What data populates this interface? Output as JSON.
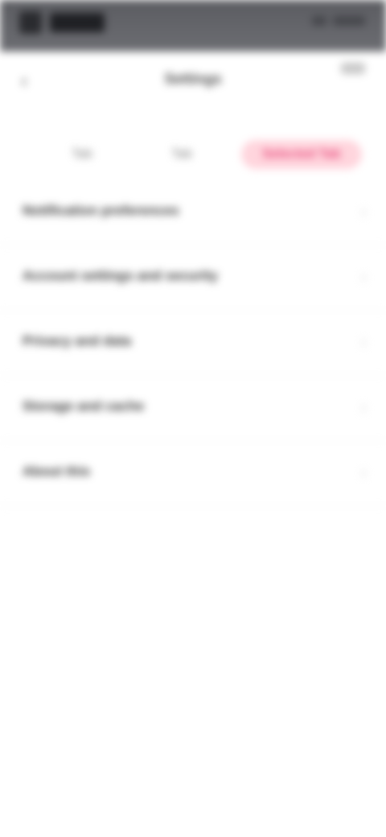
{
  "status_bar": {
    "brand": "NOIZ",
    "time": "",
    "icons": [
      "app-icon",
      "signal-icon",
      "battery-icon"
    ]
  },
  "header": {
    "title": "Settings",
    "back_icon": "back-icon",
    "action_icon": "menu-icon"
  },
  "tabs": [
    {
      "label": "Tab"
    },
    {
      "label": "Tab"
    },
    {
      "label": "Selected Tab",
      "active": true
    }
  ],
  "list": {
    "items": [
      {
        "label": "Notification preferences",
        "meta": ""
      },
      {
        "label": "Account settings and security",
        "meta": ""
      },
      {
        "label": "Privacy and data",
        "meta": ""
      },
      {
        "label": "Storage and cache",
        "meta": ""
      },
      {
        "label": "About this",
        "meta": ""
      }
    ]
  },
  "colors": {
    "status_bar": "#6c6d72",
    "accent": "#e8477a",
    "accent_bg": "#ffd5dd",
    "text": "#333333"
  }
}
